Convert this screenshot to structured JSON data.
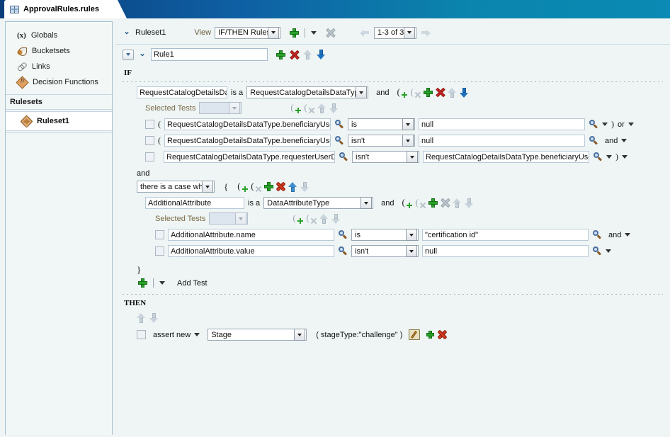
{
  "window": {
    "tab_title": "ApprovalRules.rules",
    "tab_icon": "book-icon"
  },
  "sidebar": {
    "items": [
      {
        "label": "Globals",
        "icon": "variable-icon"
      },
      {
        "label": "Bucketsets",
        "icon": "bucketsets-icon"
      },
      {
        "label": "Links",
        "icon": "links-icon"
      },
      {
        "label": "Decision Functions",
        "icon": "decision-functions-icon"
      }
    ],
    "section_header": "Rulesets",
    "rulesets": [
      {
        "label": "Ruleset1",
        "icon": "ruleset-icon"
      }
    ]
  },
  "toolbar": {
    "ruleset_name": "Ruleset1",
    "view_label": "View",
    "view_value": "IF/THEN Rules",
    "pager_value": "1-3 of 3",
    "add_icon": "plus-icon",
    "delete_icon": "delete-x-icon",
    "prev_icon": "arrow-left-icon",
    "next_icon": "arrow-right-icon"
  },
  "rule": {
    "name": "Rule1",
    "add_icon": "plus-icon",
    "delete_icon": "delete-x-icon",
    "move_up_icon": "arrow-up-icon",
    "move_down_icon": "arrow-down-icon"
  },
  "if_section": {
    "title": "IF",
    "pattern": {
      "variable": "RequestCatalogDetailsData",
      "is_a_label": "is a",
      "type": "RequestCatalogDetailsDataType",
      "connector": "and",
      "selected_tests_label": "Selected Tests",
      "selected_tests_value": ""
    },
    "tests": [
      {
        "open_paren": "(",
        "left": "RequestCatalogDetailsDataType.beneficiaryUserDat",
        "operator": "is",
        "right": "null",
        "close_paren": ")",
        "connector": "or"
      },
      {
        "open_paren": "(",
        "left": "RequestCatalogDetailsDataType.beneficiaryUserDat",
        "operator": "isn't",
        "right": "null",
        "close_paren": "",
        "connector": "and"
      },
      {
        "open_paren": "",
        "left": "RequestCatalogDetailsDataType.requesterUserData",
        "operator": "isn't",
        "right": "RequestCatalogDetailsDataType.beneficiaryUserDat",
        "close_paren": ")",
        "connector": ""
      }
    ],
    "nested": {
      "connector": "and",
      "quantifier": "there is a case where",
      "open_brace": "{",
      "close_brace": "}",
      "pattern": {
        "variable": "AdditionalAttribute",
        "is_a_label": "is a",
        "type": "DataAttributeType",
        "connector": "and",
        "selected_tests_label": "Selected Tests",
        "selected_tests_value": ""
      },
      "tests": [
        {
          "left": "AdditionalAttribute.name",
          "operator": "is",
          "right": "\"certification id\"",
          "connector": "and"
        },
        {
          "left": "AdditionalAttribute.value",
          "operator": "isn't",
          "right": "null",
          "connector": ""
        }
      ]
    },
    "add_test_label": "Add Test"
  },
  "then_section": {
    "title": "THEN",
    "move_up_icon": "arrow-up-icon",
    "move_down_icon": "arrow-down-icon",
    "actions": [
      {
        "action": "assert new",
        "target": "Stage",
        "properties": "( stageType:\"challenge\" )",
        "edit_icon": "pencil-icon",
        "add_icon": "plus-icon",
        "delete_icon": "delete-burst-icon"
      }
    ]
  },
  "colors": {
    "header_start": "#0a3d7a",
    "header_end": "#0a8ab4",
    "panel_bg": "#eef5f4",
    "accent_green": "#2aa02a",
    "accent_red": "#cc2b24",
    "accent_blue": "#1f72c0",
    "label_brown": "#6a5b3e"
  }
}
